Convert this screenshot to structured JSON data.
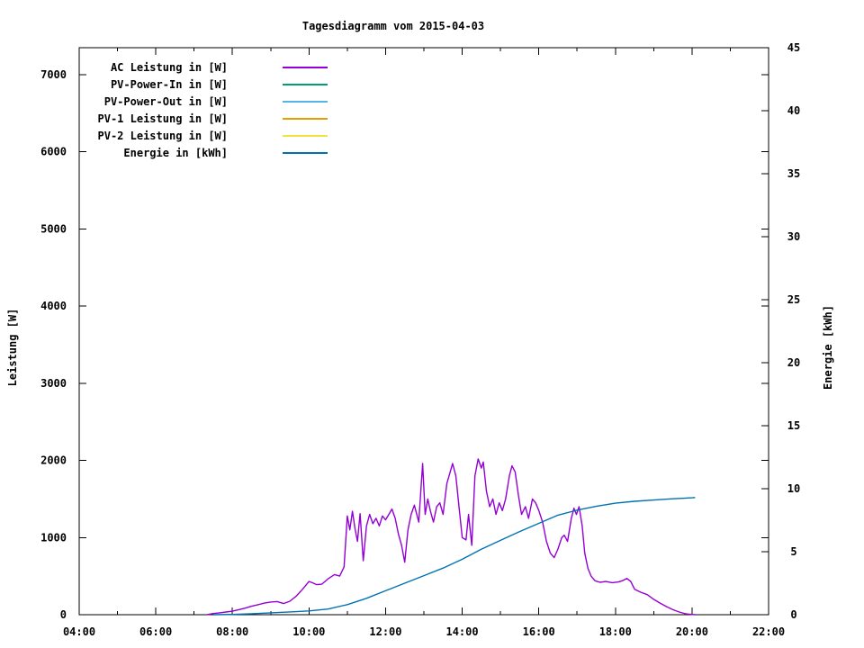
{
  "title": "Tagesdiagramm vom 2015-04-03",
  "chart_data": {
    "type": "line",
    "title": "Tagesdiagramm vom 2015-04-03",
    "grid": false,
    "legend_position": "top-left-inside",
    "x_axis": {
      "kind": "time",
      "range_hours": [
        4,
        22
      ],
      "major_tick_labels": [
        "04:00",
        "06:00",
        "08:00",
        "10:00",
        "12:00",
        "14:00",
        "16:00",
        "18:00",
        "20:00",
        "22:00"
      ],
      "major_step_hours": 2,
      "minor_step_hours": 1
    },
    "y_left": {
      "label": "Leistung [W]",
      "range": [
        0,
        7350
      ],
      "tick_values": [
        0,
        1000,
        2000,
        3000,
        4000,
        5000,
        6000,
        7000
      ],
      "tick_labels": [
        "0",
        "1000",
        "2000",
        "3000",
        "4000",
        "5000",
        "6000",
        "7000"
      ]
    },
    "y_right": {
      "label": "Energie [kWh]",
      "range": [
        0,
        45
      ],
      "tick_values": [
        0,
        5,
        10,
        15,
        20,
        25,
        30,
        35,
        40,
        45
      ],
      "tick_labels": [
        "0",
        "5",
        "10",
        "15",
        "20",
        "25",
        "30",
        "35",
        "40",
        "45"
      ]
    },
    "legend": [
      {
        "label": "AC Leistung in [W]",
        "color": "#9400d3"
      },
      {
        "label": "PV-Power-In in [W]",
        "color": "#009e73"
      },
      {
        "label": "PV-Power-Out in [W]",
        "color": "#56b4e9"
      },
      {
        "label": "PV-1 Leistung in [W]",
        "color": "#e69f00"
      },
      {
        "label": "PV-2 Leistung in [W]",
        "color": "#f0e442"
      },
      {
        "label": "Energie in [kWh]",
        "color": "#0072b2"
      }
    ],
    "series": [
      {
        "name": "AC Leistung in [W]",
        "axis": "left",
        "color": "#9400d3",
        "points": [
          [
            "07:20",
            0
          ],
          [
            "07:30",
            15
          ],
          [
            "07:40",
            25
          ],
          [
            "07:50",
            35
          ],
          [
            "08:00",
            45
          ],
          [
            "08:10",
            65
          ],
          [
            "08:20",
            85
          ],
          [
            "08:30",
            110
          ],
          [
            "08:40",
            130
          ],
          [
            "08:50",
            150
          ],
          [
            "09:00",
            165
          ],
          [
            "09:10",
            170
          ],
          [
            "09:20",
            145
          ],
          [
            "09:30",
            175
          ],
          [
            "09:40",
            240
          ],
          [
            "09:50",
            330
          ],
          [
            "10:00",
            430
          ],
          [
            "10:05",
            415
          ],
          [
            "10:12",
            390
          ],
          [
            "10:20",
            395
          ],
          [
            "10:30",
            465
          ],
          [
            "10:40",
            520
          ],
          [
            "10:48",
            500
          ],
          [
            "10:55",
            620
          ],
          [
            "11:00",
            1280
          ],
          [
            "11:04",
            1100
          ],
          [
            "11:08",
            1340
          ],
          [
            "11:12",
            1120
          ],
          [
            "11:16",
            950
          ],
          [
            "11:20",
            1310
          ],
          [
            "11:25",
            700
          ],
          [
            "11:30",
            1150
          ],
          [
            "11:35",
            1300
          ],
          [
            "11:40",
            1180
          ],
          [
            "11:45",
            1250
          ],
          [
            "11:50",
            1150
          ],
          [
            "11:55",
            1280
          ],
          [
            "12:00",
            1230
          ],
          [
            "12:05",
            1300
          ],
          [
            "12:10",
            1370
          ],
          [
            "12:15",
            1250
          ],
          [
            "12:20",
            1050
          ],
          [
            "12:25",
            900
          ],
          [
            "12:30",
            680
          ],
          [
            "12:35",
            1100
          ],
          [
            "12:40",
            1300
          ],
          [
            "12:45",
            1420
          ],
          [
            "12:52",
            1200
          ],
          [
            "12:58",
            1960
          ],
          [
            "13:02",
            1300
          ],
          [
            "13:06",
            1500
          ],
          [
            "13:10",
            1350
          ],
          [
            "13:15",
            1200
          ],
          [
            "13:20",
            1400
          ],
          [
            "13:25",
            1450
          ],
          [
            "13:30",
            1300
          ],
          [
            "13:36",
            1700
          ],
          [
            "13:45",
            1960
          ],
          [
            "13:50",
            1800
          ],
          [
            "13:55",
            1400
          ],
          [
            "14:00",
            1000
          ],
          [
            "14:06",
            970
          ],
          [
            "14:10",
            1300
          ],
          [
            "14:15",
            900
          ],
          [
            "14:20",
            1800
          ],
          [
            "14:25",
            2020
          ],
          [
            "14:30",
            1900
          ],
          [
            "14:33",
            1980
          ],
          [
            "14:38",
            1600
          ],
          [
            "14:43",
            1400
          ],
          [
            "14:48",
            1500
          ],
          [
            "14:53",
            1300
          ],
          [
            "14:58",
            1450
          ],
          [
            "15:03",
            1350
          ],
          [
            "15:08",
            1500
          ],
          [
            "15:14",
            1800
          ],
          [
            "15:18",
            1930
          ],
          [
            "15:23",
            1850
          ],
          [
            "15:28",
            1550
          ],
          [
            "15:33",
            1300
          ],
          [
            "15:39",
            1400
          ],
          [
            "15:44",
            1250
          ],
          [
            "15:50",
            1500
          ],
          [
            "15:55",
            1450
          ],
          [
            "16:00",
            1350
          ],
          [
            "16:06",
            1200
          ],
          [
            "16:12",
            950
          ],
          [
            "16:18",
            800
          ],
          [
            "16:24",
            740
          ],
          [
            "16:30",
            850
          ],
          [
            "16:36",
            1000
          ],
          [
            "16:40",
            1030
          ],
          [
            "16:45",
            950
          ],
          [
            "16:51",
            1250
          ],
          [
            "16:55",
            1380
          ],
          [
            "16:59",
            1300
          ],
          [
            "17:03",
            1400
          ],
          [
            "17:08",
            1150
          ],
          [
            "17:12",
            800
          ],
          [
            "17:17",
            600
          ],
          [
            "17:22",
            500
          ],
          [
            "17:28",
            440
          ],
          [
            "17:36",
            420
          ],
          [
            "17:45",
            430
          ],
          [
            "17:55",
            415
          ],
          [
            "18:05",
            425
          ],
          [
            "18:12",
            445
          ],
          [
            "18:18",
            470
          ],
          [
            "18:24",
            430
          ],
          [
            "18:30",
            330
          ],
          [
            "18:40",
            290
          ],
          [
            "18:50",
            260
          ],
          [
            "19:00",
            200
          ],
          [
            "19:10",
            150
          ],
          [
            "19:20",
            105
          ],
          [
            "19:30",
            65
          ],
          [
            "19:40",
            35
          ],
          [
            "19:50",
            12
          ],
          [
            "20:00",
            3
          ],
          [
            "20:05",
            0
          ]
        ]
      },
      {
        "name": "PV-Power-In in [W]",
        "axis": "left",
        "color": "#009e73",
        "points": []
      },
      {
        "name": "PV-Power-Out in [W]",
        "axis": "left",
        "color": "#56b4e9",
        "points": []
      },
      {
        "name": "PV-1 Leistung in [W]",
        "axis": "left",
        "color": "#e69f00",
        "points": []
      },
      {
        "name": "PV-2 Leistung in [W]",
        "axis": "left",
        "color": "#f0e442",
        "points": []
      },
      {
        "name": "Energie in [kWh]",
        "axis": "right",
        "color": "#0072b2",
        "points": [
          [
            "07:30",
            0
          ],
          [
            "08:00",
            0.02
          ],
          [
            "08:30",
            0.08
          ],
          [
            "09:00",
            0.15
          ],
          [
            "09:30",
            0.22
          ],
          [
            "10:00",
            0.3
          ],
          [
            "10:30",
            0.45
          ],
          [
            "11:00",
            0.8
          ],
          [
            "11:30",
            1.3
          ],
          [
            "12:00",
            1.9
          ],
          [
            "12:30",
            2.5
          ],
          [
            "13:00",
            3.1
          ],
          [
            "13:30",
            3.7
          ],
          [
            "14:00",
            4.4
          ],
          [
            "14:30",
            5.2
          ],
          [
            "15:00",
            5.9
          ],
          [
            "15:30",
            6.6
          ],
          [
            "16:00",
            7.25
          ],
          [
            "16:30",
            7.9
          ],
          [
            "17:00",
            8.3
          ],
          [
            "17:30",
            8.6
          ],
          [
            "18:00",
            8.85
          ],
          [
            "18:30",
            9.0
          ],
          [
            "19:00",
            9.1
          ],
          [
            "19:30",
            9.2
          ],
          [
            "20:00",
            9.28
          ],
          [
            "20:05",
            9.3
          ]
        ]
      }
    ]
  }
}
